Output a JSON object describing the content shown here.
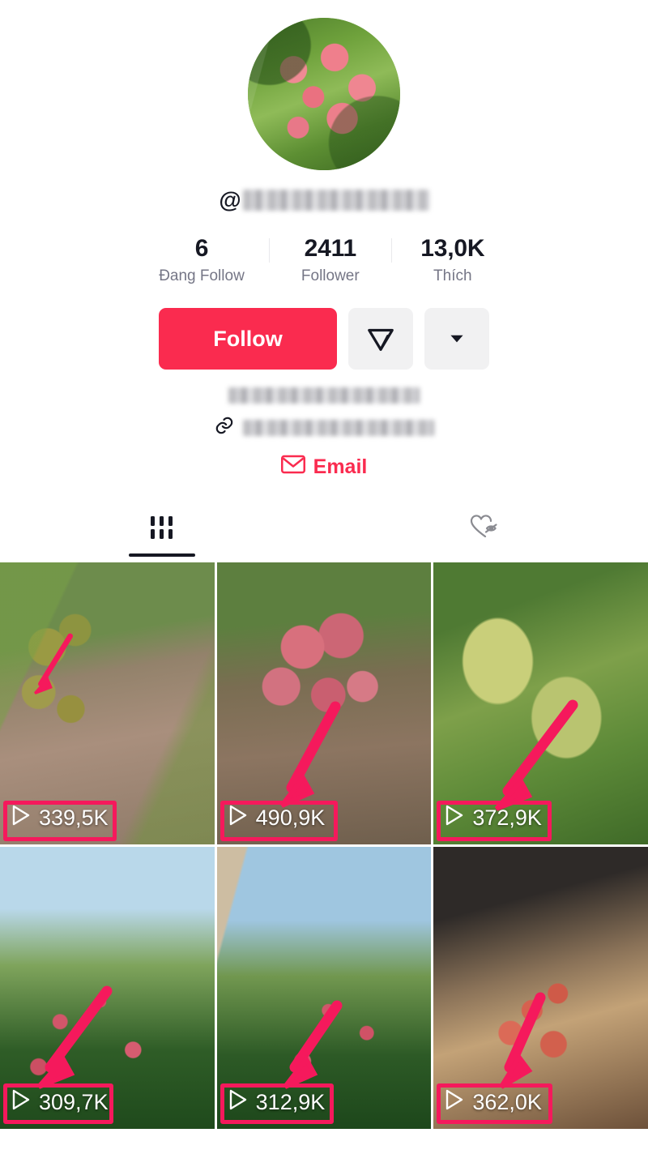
{
  "profile": {
    "avatar_icon": "lychee-photo-avatar",
    "handle_prefix": "@",
    "handle_redacted": true,
    "bio_redacted": true,
    "link_redacted": true,
    "link_icon": "link-icon"
  },
  "stats": [
    {
      "value": "6",
      "label": "Đang Follow",
      "name": "following"
    },
    {
      "value": "2411",
      "label": "Follower",
      "name": "followers"
    },
    {
      "value": "13,0K",
      "label": "Thích",
      "name": "likes"
    }
  ],
  "actions": {
    "follow_label": "Follow",
    "share_icon": "send-message-icon",
    "more_icon": "chevron-down-icon",
    "email_label": "Email",
    "email_icon": "envelope-icon"
  },
  "tabs": [
    {
      "name": "tab-videos",
      "icon": "grid-icon",
      "active": true
    },
    {
      "name": "tab-liked-private",
      "icon": "heart-eye-off-icon",
      "active": false
    }
  ],
  "videos": [
    {
      "views": "339,5K",
      "play_icon": "play-icon",
      "thumb": "lychee-unripe-on-branch"
    },
    {
      "views": "490,9K",
      "play_icon": "play-icon",
      "thumb": "lychee-ripe-cluster"
    },
    {
      "views": "372,9K",
      "play_icon": "play-icon",
      "thumb": "lychee-tree-flowering"
    },
    {
      "views": "309,7K",
      "play_icon": "play-icon",
      "thumb": "lychee-orchard-sky"
    },
    {
      "views": "312,9K",
      "play_icon": "play-icon",
      "thumb": "lychee-orchard-wide"
    },
    {
      "views": "362,0K",
      "play_icon": "play-icon",
      "thumb": "lychee-bouquet-selfie"
    }
  ],
  "colors": {
    "accent": "#fa2b4f",
    "annotation": "#f5195c",
    "text_primary": "#161823",
    "text_secondary": "#757686",
    "button_gray": "#f1f1f2"
  }
}
